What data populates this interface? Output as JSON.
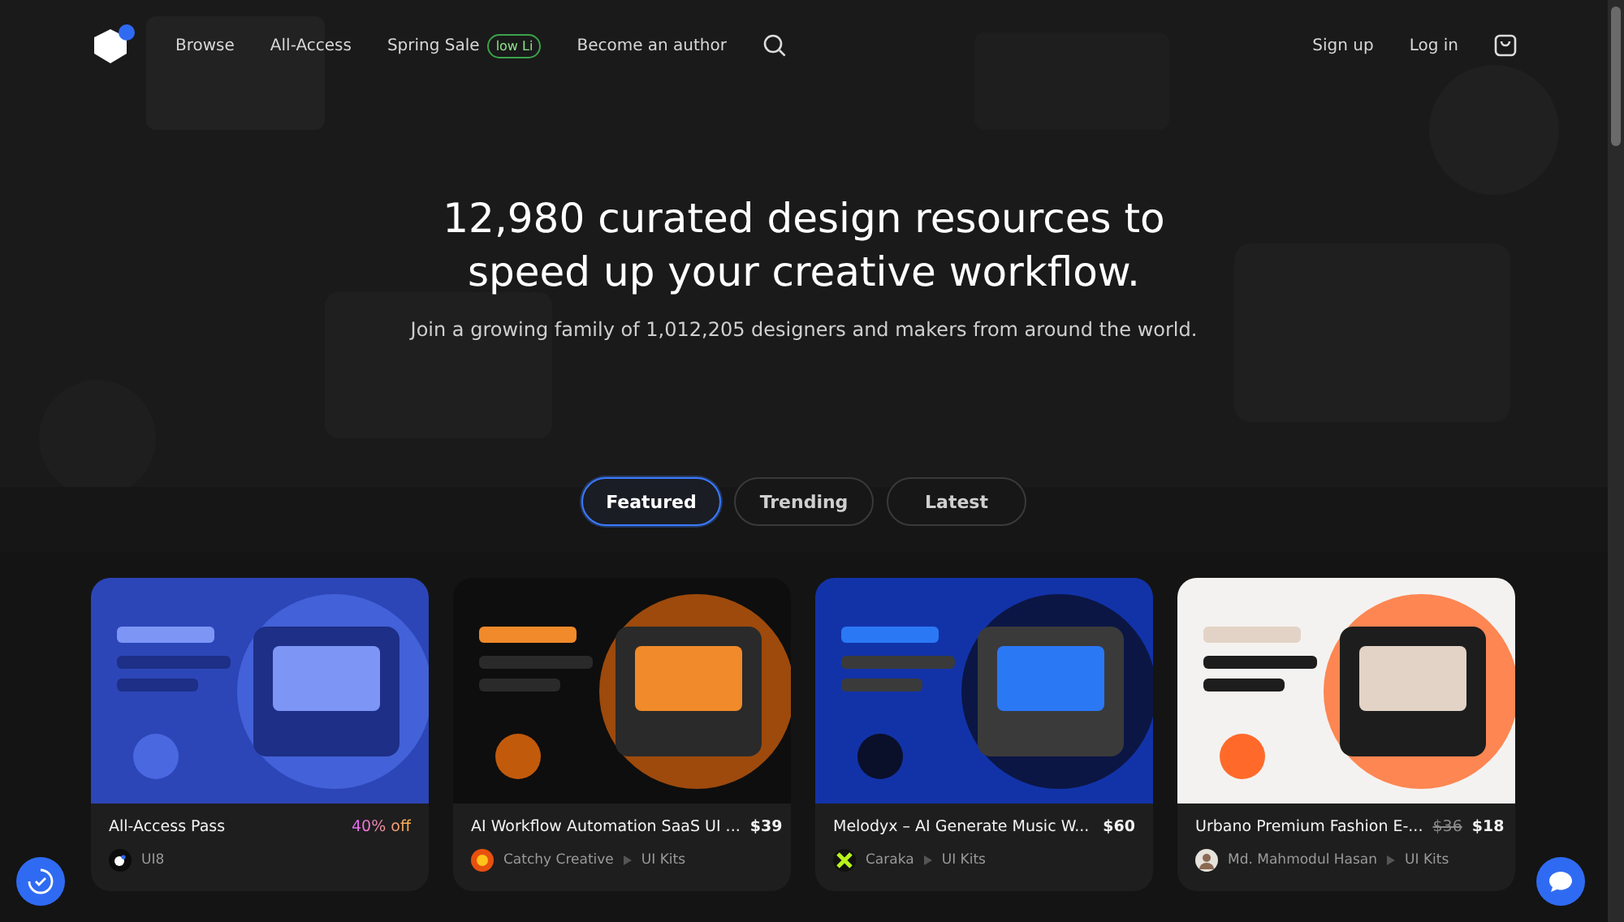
{
  "nav": {
    "links": [
      {
        "label": "Browse"
      },
      {
        "label": "All-Access"
      },
      {
        "label": "Spring Sale",
        "badge": "low Li"
      },
      {
        "label": "Become an author"
      }
    ],
    "actions": [
      {
        "label": "Sign up"
      },
      {
        "label": "Log in"
      }
    ]
  },
  "hero": {
    "title": "12,980 curated design resources to speed up your creative workflow.",
    "subtitle": "Join a growing family of 1,012,205 designers and makers from around the world."
  },
  "tabs": [
    {
      "label": "Featured",
      "selected": true
    },
    {
      "label": "Trending",
      "selected": false
    },
    {
      "label": "Latest",
      "selected": false
    }
  ],
  "products": [
    {
      "title": "All-Access Pass",
      "kind": "discount",
      "price": "40% off",
      "author": "UI8",
      "avatar": {
        "kind": "logo"
      }
    },
    {
      "title": "AI Workflow Automation SaaS UI ...",
      "kind": "plain",
      "price": "$39",
      "author": "Catchy Creative",
      "category": "UI Kits",
      "avatar": {
        "kind": "sun"
      }
    },
    {
      "title": "Melodyx – AI Generate Music W...",
      "kind": "plain",
      "price": "$60",
      "author": "Caraka",
      "category": "UI Kits",
      "avatar": {
        "kind": "cross"
      }
    },
    {
      "title": "Urbano Premium Fashion E-...",
      "kind": "sale",
      "old_price": "$36",
      "price": "$18",
      "author": "Md. Mahmodul Hasan",
      "category": "UI Kits",
      "avatar": {
        "kind": "person"
      }
    }
  ]
}
